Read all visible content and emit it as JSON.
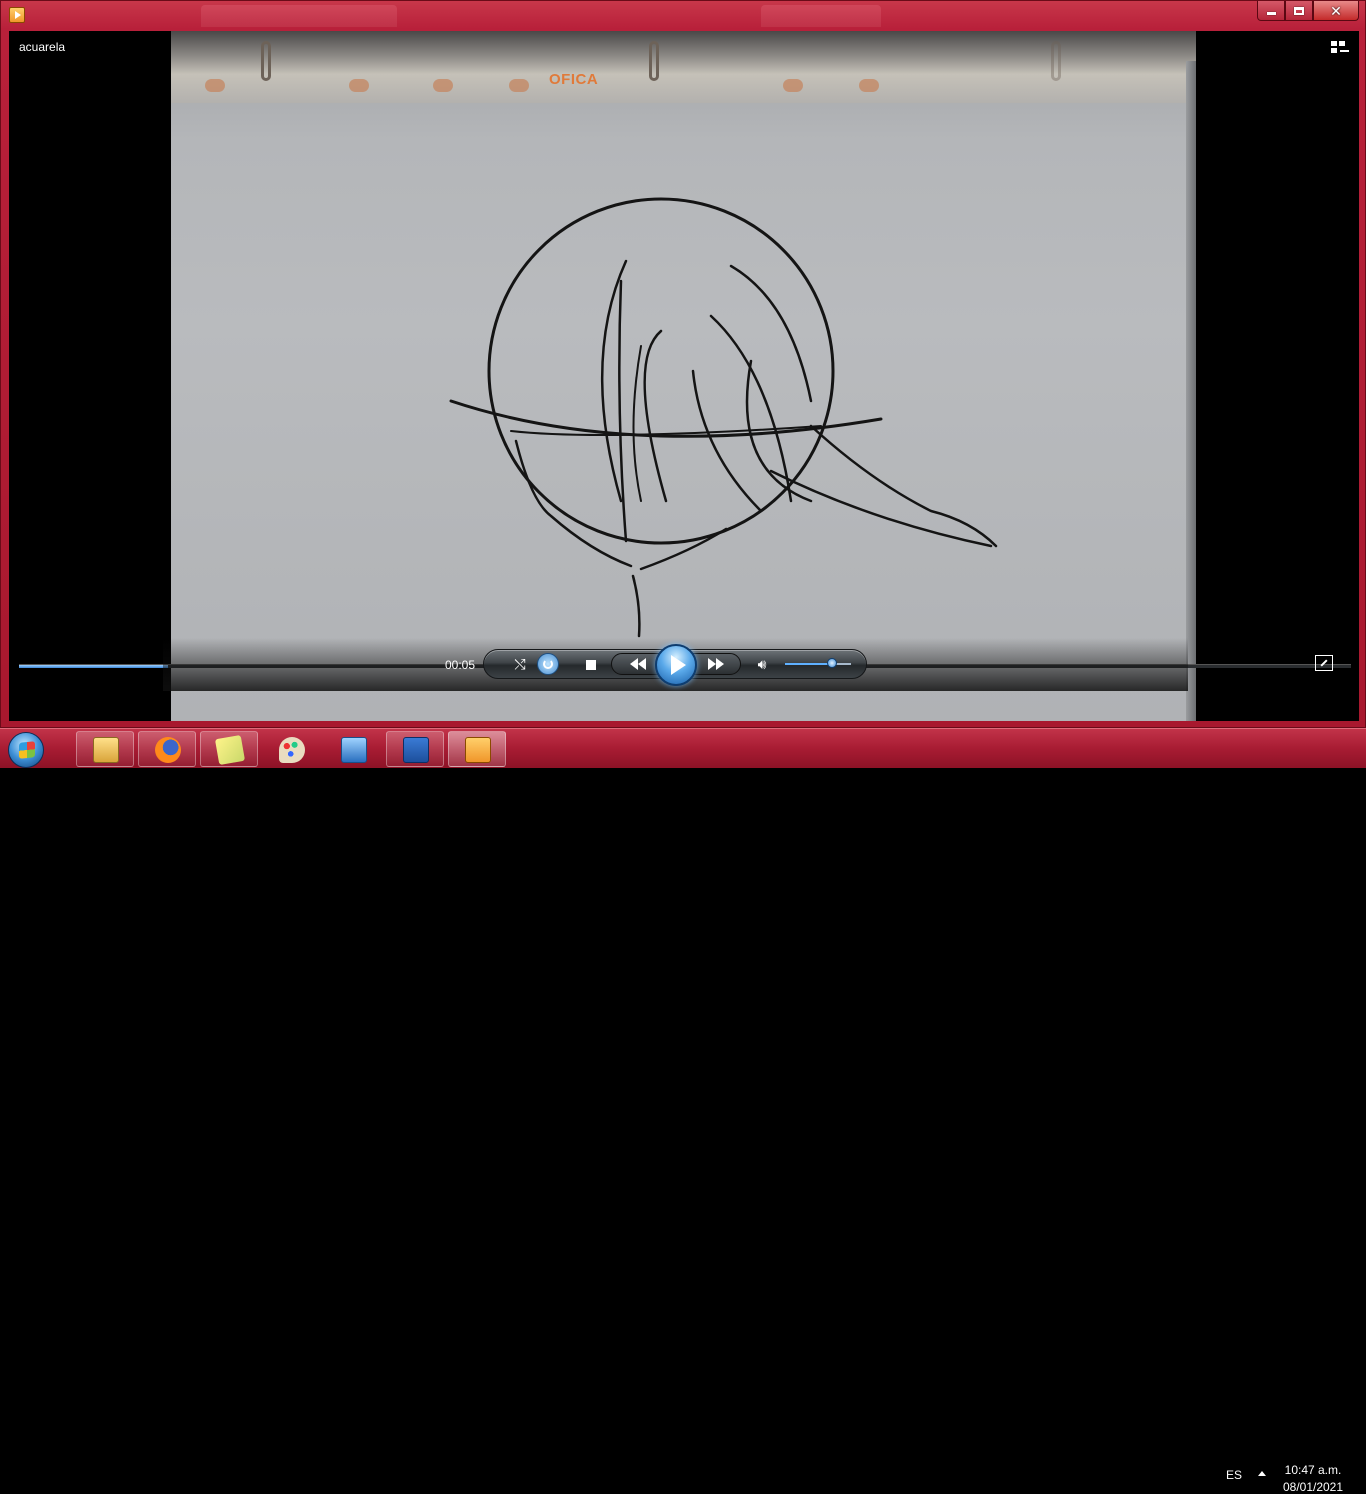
{
  "window": {
    "video_title": "acuarela"
  },
  "player": {
    "current_time": "00:05",
    "seek_progress": 0.112,
    "volume_level": 0.7,
    "brand_on_paper": "OFICA"
  },
  "icons": {
    "app": "media-player-icon",
    "shuffle": "shuffle-icon",
    "repeat": "repeat-icon",
    "stop": "stop-icon",
    "previous": "rewind-icon",
    "play": "play-icon",
    "next": "fast-forward-icon",
    "mute": "speaker-icon",
    "fullscreen": "fullscreen-icon",
    "library": "switch-to-library-icon"
  },
  "taskbar": {
    "language": "ES",
    "time": "10:47 a.m.",
    "date": "08/01/2021",
    "apps": [
      {
        "name": "file-explorer-icon"
      },
      {
        "name": "firefox-icon"
      },
      {
        "name": "sticky-notes-icon"
      },
      {
        "name": "paint-icon"
      },
      {
        "name": "control-panel-icon"
      },
      {
        "name": "word-icon"
      },
      {
        "name": "media-player-icon"
      }
    ]
  },
  "colors": {
    "window_frame": "#b8203a",
    "taskbar": "#a81c33",
    "accent_blue": "#3a86d8"
  }
}
